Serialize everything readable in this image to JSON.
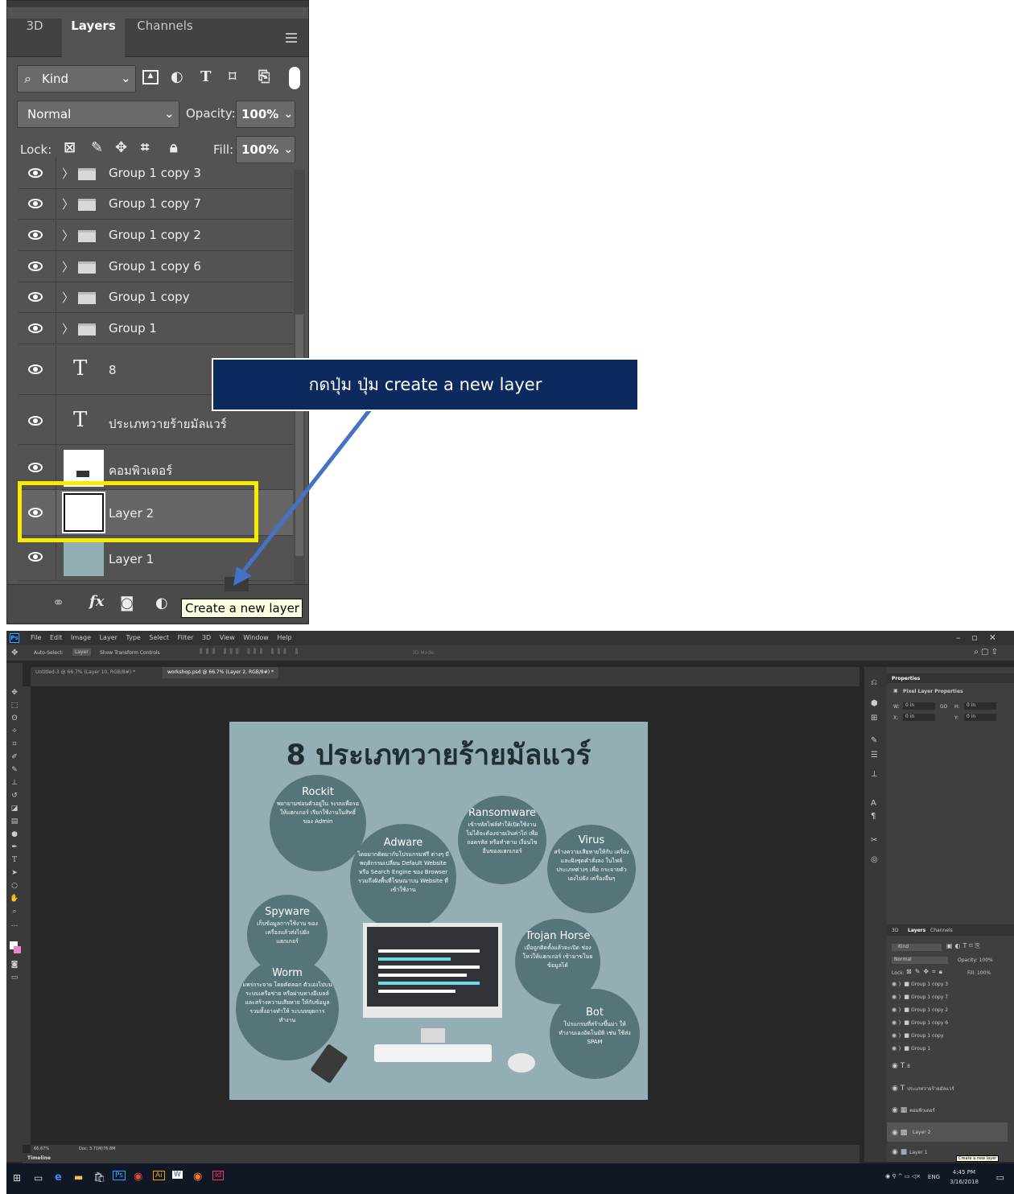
{
  "zoom_panel": {
    "tabs": [
      "3D",
      "Layers",
      "Channels"
    ],
    "filter_kind": "Kind",
    "blend_mode": "Normal",
    "opacity_label": "Opacity:",
    "opacity_value": "100%",
    "lock_label": "Lock:",
    "fill_label": "Fill:",
    "fill_value": "100%",
    "layers": [
      {
        "name": "Group 1 copy 3",
        "type": "group"
      },
      {
        "name": "Group 1 copy 7",
        "type": "group"
      },
      {
        "name": "Group 1 copy 2",
        "type": "group"
      },
      {
        "name": "Group 1 copy 6",
        "type": "group"
      },
      {
        "name": "Group 1 copy",
        "type": "group"
      },
      {
        "name": "Group 1",
        "type": "group"
      },
      {
        "name": "8",
        "type": "text"
      },
      {
        "name": "ประเภทวายร้ายมัลแวร์",
        "type": "text"
      },
      {
        "name": "คอมพิวเตอร์",
        "type": "image"
      },
      {
        "name": "Layer 2",
        "type": "pixel"
      },
      {
        "name": "Layer 1",
        "type": "pixel"
      }
    ],
    "tooltip": "Create a new layer"
  },
  "callout": {
    "text": "กดปุ่ม ปุ่ม create a new layer"
  },
  "photoshop": {
    "menu": [
      "File",
      "Edit",
      "Image",
      "Layer",
      "Type",
      "Select",
      "Filter",
      "3D",
      "View",
      "Window",
      "Help"
    ],
    "options_bar": {
      "auto_select": "Auto-Select:",
      "auto_select_target": "Layer",
      "show_transform": "Show Transform Controls",
      "mode_3d": "3D Mode:"
    },
    "doc_tabs": [
      "Untitled-3 @ 66.7% (Layer 10, RGB/8#) *",
      "workshop.psd @ 66.7% (Layer 2, RGB/8#) *"
    ],
    "status": {
      "zoom": "66.67%",
      "doc": "Doc: 3.71M/76.8M"
    },
    "timeline_label": "Timeline",
    "properties": {
      "title": "Properties",
      "subtitle": "Pixel Layer Properties",
      "w_label": "W:",
      "w_value": "0 in",
      "go_label": "GO",
      "h_label": "H:",
      "h_value": "0 in",
      "x_label": "X:",
      "x_value": "0 in",
      "y_label": "Y:",
      "y_value": "0 in"
    },
    "layers_panel": {
      "tabs": [
        "3D",
        "Layers",
        "Channels"
      ],
      "kind": "Kind",
      "blend": "Normal",
      "opacity": "Opacity: 100%",
      "fill": "Fill: 100%",
      "lock": "Lock:",
      "tooltip": "Create a new layer"
    },
    "taskbar": {
      "lang": "ENG",
      "time": "4:45 PM",
      "date": "3/16/2018"
    }
  },
  "infographic": {
    "title": "8 ประเภทวายร้ายมัลแวร์",
    "bubbles": [
      {
        "title": "Rockit",
        "desc": "พยายามซ่อนตัวอยู่ใน ระบบเพื่อรอให้แฮกเกอร์ เรียกใช้งานในสิทธิ์ของ Admin"
      },
      {
        "title": "Adware",
        "desc": "โดยมากติดมากับโปรแกรมฟรี ต่างๆ มีพฤติกรรมเปลี่ยน Default Website หรือ Search Engine ของ Browser รวมถึงฝังพื้นที่โฆษณาบน Website ที่เข้าใช้งาน"
      },
      {
        "title": "Ransomware",
        "desc": "เข้ารหัสไฟล์ทำให้เปิดใช้งาน ไม่ได้จะต้องจ่ายเงินค่าไถ่ เพื่อถอดรหัส หรือทำตาม เงื่อนไขอื่นของแฮกเกอร์"
      },
      {
        "title": "Virus",
        "desc": "สร้างความเสียหายให้กับ เครื่องและฝังชุดคำสั่งลง ในไฟล์ประเภทต่างๆ เพื่อ กระจายตัวเองไปยัง เครื่องอื่นๆ"
      },
      {
        "title": "Spyware",
        "desc": "เก็บข้อมูลการใช้งาน ของเครื่องแล้วส่งไปยัง แฮกเกอร์"
      },
      {
        "title": "Trojan Horse",
        "desc": "เมื่อถูกติดตั้งแล้วจะเปิด ช่องโหว่ให้แฮกเกอร์ เข้ามาขโมยข้อมูลได้"
      },
      {
        "title": "Worm",
        "desc": "แพร่กระจาย โดยคัดลอก ตัวเองไปบนระบบเครือข่าย หรือผ่านทางอีเมลล์ และสร้างความเสียหาย ให้กับข้อมูลรวมทั้งอาจทำให้ ระบบหยุดการทำงาน"
      },
      {
        "title": "Bot",
        "desc": "โปรแกรมที่สร้างขึ้นมา ให้ทำงานเองอัตโนมัติ เช่น ใช้ส่ง SPAM"
      }
    ]
  }
}
